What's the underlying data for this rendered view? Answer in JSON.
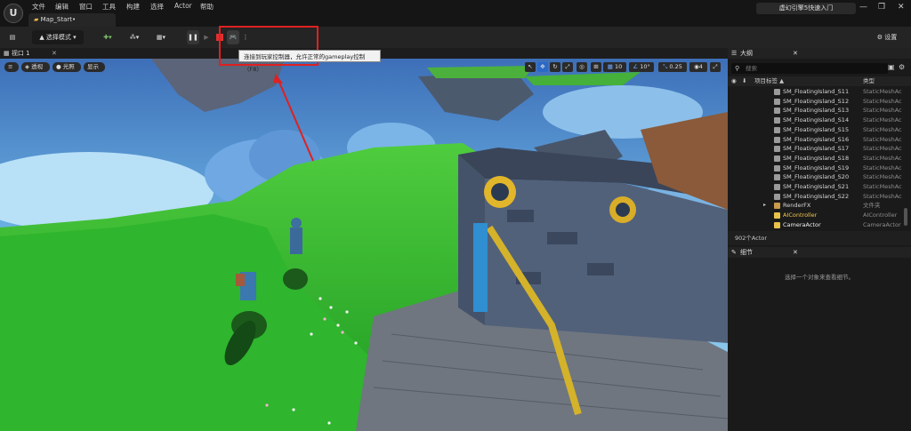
{
  "menu": [
    "文件",
    "编辑",
    "窗口",
    "工具",
    "构建",
    "选择",
    "Actor",
    "帮助"
  ],
  "tab": {
    "label": "Map_Start•"
  },
  "brand": "虚幻引擎5快速入门",
  "window_controls": [
    "—",
    "❐",
    "✕"
  ],
  "toolbar": {
    "mode_label": "选择模式",
    "settings_label": "设置"
  },
  "tooltip": "连接到玩家控制器，允许正常的gameplay控制（F8）",
  "viewport": {
    "tab_label": "视口 1",
    "buttons": [
      "透视",
      "光照",
      "显示"
    ],
    "grid_value": "10",
    "angle_value": "10°",
    "scale_value": "0.25",
    "camera_speed": "4"
  },
  "outliner": {
    "title": "大纲",
    "search_placeholder": "搜索",
    "col_name": "项目标签 ▲",
    "col_type": "类型",
    "rows": [
      {
        "name": "SM_FloatingIsland_S11",
        "type": "StaticMeshAc"
      },
      {
        "name": "SM_FloatingIsland_S12",
        "type": "StaticMeshAc"
      },
      {
        "name": "SM_FloatingIsland_S13",
        "type": "StaticMeshAc"
      },
      {
        "name": "SM_FloatingIsland_S14",
        "type": "StaticMeshAc"
      },
      {
        "name": "SM_FloatingIsland_S15",
        "type": "StaticMeshAc"
      },
      {
        "name": "SM_FloatingIsland_S16",
        "type": "StaticMeshAc"
      },
      {
        "name": "SM_FloatingIsland_S17",
        "type": "StaticMeshAc"
      },
      {
        "name": "SM_FloatingIsland_S18",
        "type": "StaticMeshAc"
      },
      {
        "name": "SM_FloatingIsland_S19",
        "type": "StaticMeshAc"
      },
      {
        "name": "SM_FloatingIsland_S20",
        "type": "StaticMeshAc"
      },
      {
        "name": "SM_FloatingIsland_S21",
        "type": "StaticMeshAc"
      },
      {
        "name": "SM_FloatingIsland_S22",
        "type": "StaticMeshAc"
      },
      {
        "name": "RenderFX",
        "type": "文件夹"
      },
      {
        "name": "AIController",
        "type": "AIController"
      },
      {
        "name": "CameraActor",
        "type": "CameraActor"
      }
    ],
    "count": "902个Actor"
  },
  "details": {
    "title": "细节",
    "empty_text": "选择一个对象来查看细节。"
  }
}
